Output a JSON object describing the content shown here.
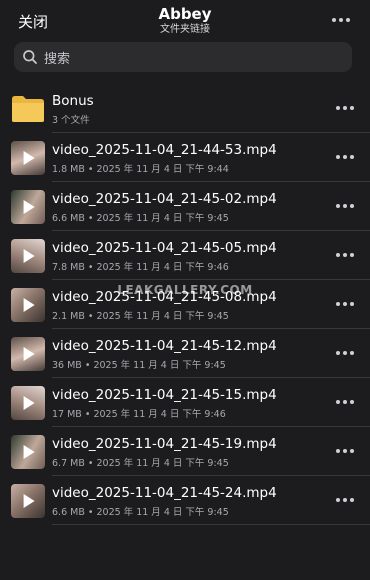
{
  "header": {
    "close_label": "关闭",
    "title": "Abbey",
    "subtitle": "文件夹链接",
    "more_icon": "more-horizontal-icon"
  },
  "search": {
    "placeholder": "搜索",
    "icon": "search-icon"
  },
  "items": [
    {
      "type": "folder",
      "name": "Bonus",
      "meta": "3 个文件"
    },
    {
      "type": "video",
      "name": "video_2025-11-04_21-44-53.mp4",
      "meta": "1.8 MB • 2025 年 11 月 4 日 下午 9:44"
    },
    {
      "type": "video",
      "name": "video_2025-11-04_21-45-02.mp4",
      "meta": "6.6 MB • 2025 年 11 月 4 日 下午 9:45"
    },
    {
      "type": "video",
      "name": "video_2025-11-04_21-45-05.mp4",
      "meta": "7.8 MB • 2025 年 11 月 4 日 下午 9:46"
    },
    {
      "type": "video",
      "name": "video_2025-11-04_21-45-08.mp4",
      "meta": "2.1 MB • 2025 年 11 月 4 日 下午 9:45"
    },
    {
      "type": "video",
      "name": "video_2025-11-04_21-45-12.mp4",
      "meta": "36 MB • 2025 年 11 月 4 日 下午 9:45"
    },
    {
      "type": "video",
      "name": "video_2025-11-04_21-45-15.mp4",
      "meta": "17 MB • 2025 年 11 月 4 日 下午 9:46"
    },
    {
      "type": "video",
      "name": "video_2025-11-04_21-45-19.mp4",
      "meta": "6.7 MB • 2025 年 11 月 4 日 下午 9:45"
    },
    {
      "type": "video",
      "name": "video_2025-11-04_21-45-24.mp4",
      "meta": "6.6 MB • 2025 年 11 月 4 日 下午 9:45"
    }
  ],
  "watermark": "LEAKGALLERY.COM",
  "colors": {
    "background": "#1c1c1e",
    "folder": "#f5c85a"
  }
}
